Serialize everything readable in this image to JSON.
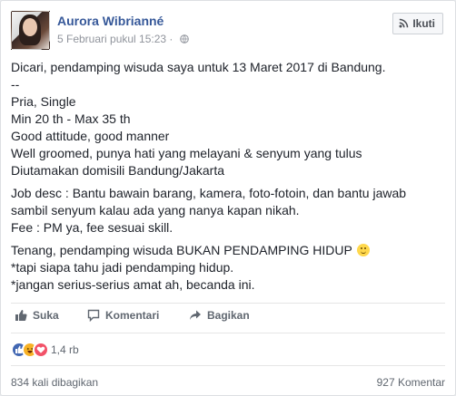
{
  "post": {
    "author": "Aurora Wibrianné",
    "timestamp": "5 Februari pukul 15:23",
    "separator": "·",
    "privacy_icon": "globe-icon",
    "follow_label": "Ikuti",
    "paragraphs": {
      "p1": [
        "Dicari, pendamping wisuda saya untuk 13 Maret 2017 di Bandung.",
        "--",
        "Pria, Single",
        "Min 20 th - Max 35 th",
        "Good attitude, good manner",
        "Well groomed, punya hati yang melayani & senyum yang tulus",
        "Diutamakan domisili Bandung/Jakarta"
      ],
      "p2": [
        "Job desc : Bantu bawain barang, kamera, foto-fotoin, dan bantu jawab",
        "sambil senyum kalau ada yang nanya kapan nikah.",
        "Fee : PM ya, fee sesuai skill."
      ],
      "p3": [
        "Tenang, pendamping wisuda BUKAN PENDAMPING HIDUP",
        "*tapi siapa tahu jadi pendamping hidup.",
        "*jangan serius-serius amat ah, becanda ini."
      ]
    },
    "emoji": "smile-emoji"
  },
  "actions": {
    "like": "Suka",
    "comment": "Komentari",
    "share": "Bagikan"
  },
  "reactions": {
    "types": [
      "like",
      "haha",
      "love"
    ],
    "count": "1,4 rb"
  },
  "footer": {
    "shares": "834 kali dibagikan",
    "comments": "927 Komentar"
  },
  "colors": {
    "link": "#365899",
    "muted": "#90949c",
    "action": "#606770",
    "like": "#4267b2",
    "haha": "#f7b125",
    "love": "#f25268"
  }
}
